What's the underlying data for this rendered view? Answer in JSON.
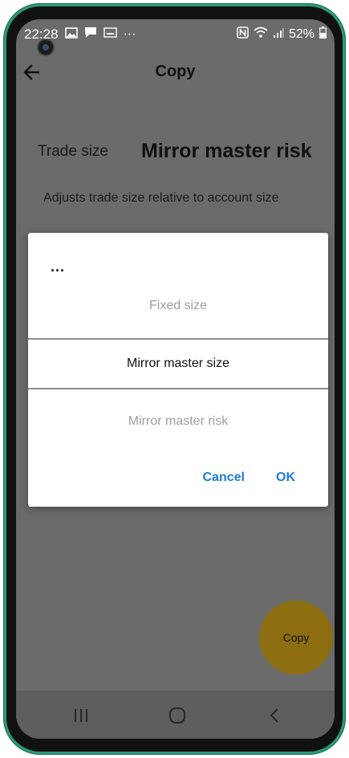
{
  "status_bar": {
    "time": "22:28",
    "more": "···",
    "battery": "52%"
  },
  "header": {
    "title": "Copy"
  },
  "trade_size": {
    "label": "Trade size",
    "value": "Mirror master risk",
    "description": "Adjusts trade size relative to account size"
  },
  "dialog": {
    "title": "...",
    "options": [
      {
        "label": "Fixed size",
        "state": "dim"
      },
      {
        "label": "Mirror master size",
        "state": "selected"
      },
      {
        "label": "Mirror master risk",
        "state": "dim"
      }
    ],
    "cancel_label": "Cancel",
    "ok_label": "OK"
  },
  "fab": {
    "label": "Copy"
  },
  "colors": {
    "accent": "#1f7bd6",
    "fab": "#8c6e10",
    "scrim": "#6b6b6b"
  }
}
